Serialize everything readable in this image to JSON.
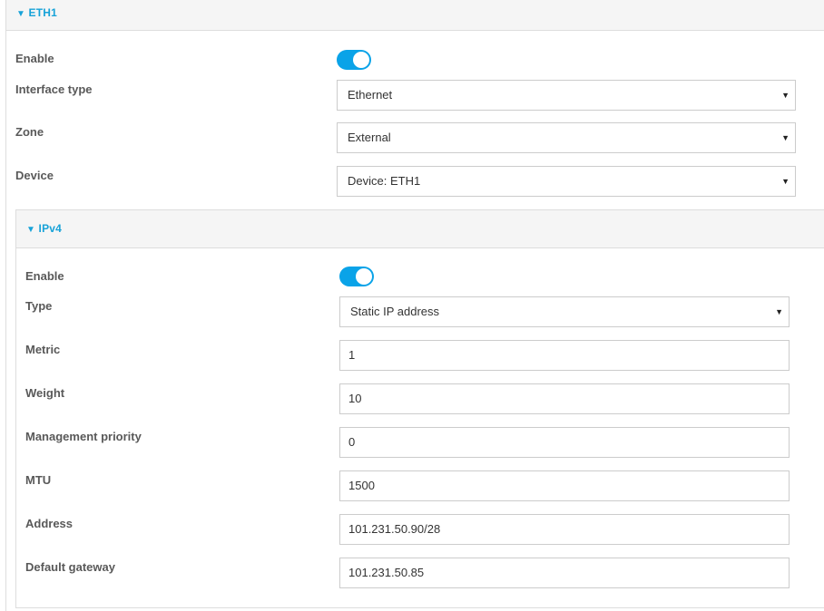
{
  "eth1": {
    "title": "ETH1",
    "arrow": "▼",
    "enable_label": "Enable",
    "enabled": true,
    "interface_type": {
      "label": "Interface type",
      "value": "Ethernet"
    },
    "zone": {
      "label": "Zone",
      "value": "External"
    },
    "device": {
      "label": "Device",
      "value": "Device: ETH1"
    }
  },
  "ipv4": {
    "title": "IPv4",
    "arrow": "▼",
    "enable_label": "Enable",
    "enabled": true,
    "type": {
      "label": "Type",
      "value": "Static IP address"
    },
    "metric": {
      "label": "Metric",
      "value": "1"
    },
    "weight": {
      "label": "Weight",
      "value": "10"
    },
    "management_priority": {
      "label": "Management priority",
      "value": "0"
    },
    "mtu": {
      "label": "MTU",
      "value": "1500"
    },
    "address": {
      "label": "Address",
      "value": "101.231.50.90/28"
    },
    "default_gateway": {
      "label": "Default gateway",
      "value": "101.231.50.85"
    }
  },
  "icons": {
    "dropdown": "▼"
  },
  "colors": {
    "accent": "#17a2d8",
    "toggle_on": "#0aa3e8",
    "header_bg": "#f5f5f5",
    "border": "#dddddd"
  }
}
